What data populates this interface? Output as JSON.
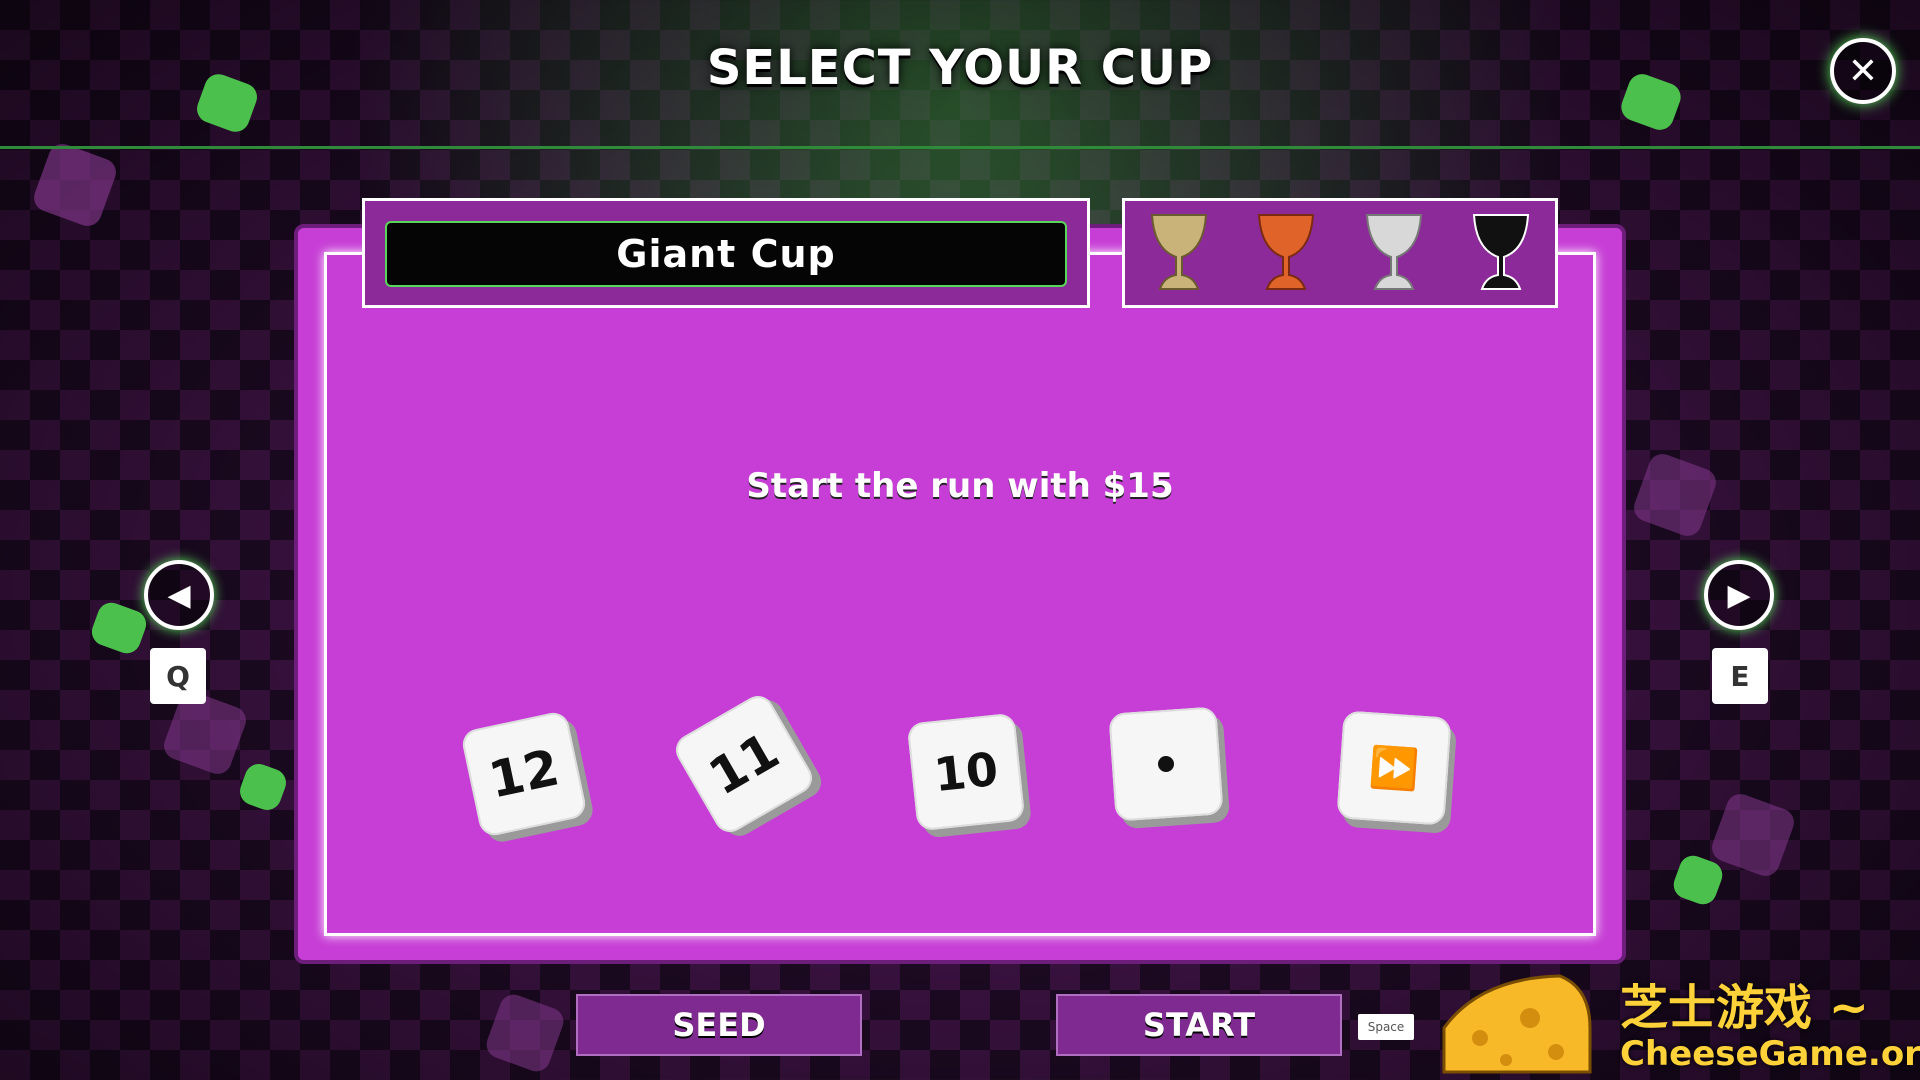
{
  "header": {
    "title": "SELECT YOUR CUP",
    "close_icon": "close-icon"
  },
  "cup_name": "Giant Cup",
  "cups": [
    {
      "name": "gold-cup",
      "color": "#c9b378"
    },
    {
      "name": "orange-cup",
      "color": "#e0642a"
    },
    {
      "name": "silver-cup",
      "color": "#d8d8d8"
    },
    {
      "name": "black-cup",
      "color": "#111111"
    }
  ],
  "description": "Start the run with $15",
  "dice": [
    {
      "face": "12"
    },
    {
      "face": "11"
    },
    {
      "face": "10"
    },
    {
      "face": "1"
    },
    {
      "face": "special"
    }
  ],
  "nav": {
    "prev_key": "Q",
    "next_key": "E"
  },
  "buttons": {
    "seed": "SEED",
    "start": "START",
    "start_key": "Space"
  },
  "watermark": {
    "cn": "芝士游戏 ~",
    "en": "CheeseGame.org"
  },
  "colors": {
    "panel": "#c73ed6",
    "accent_green": "#5be35b"
  }
}
